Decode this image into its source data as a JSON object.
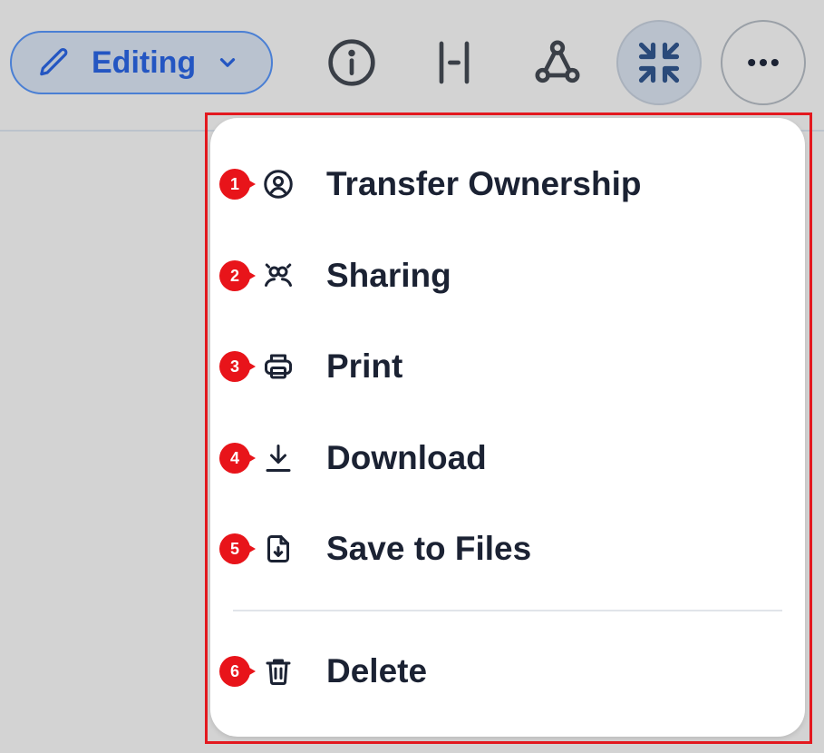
{
  "toolbar": {
    "editing_label": "Editing"
  },
  "menu": {
    "items": [
      {
        "badge": "1",
        "label": "Transfer Ownership",
        "icon": "user-circle-icon"
      },
      {
        "badge": "2",
        "label": "Sharing",
        "icon": "users-icon"
      },
      {
        "badge": "3",
        "label": "Print",
        "icon": "printer-icon"
      },
      {
        "badge": "4",
        "label": "Download",
        "icon": "download-icon"
      },
      {
        "badge": "5",
        "label": "Save to Files",
        "icon": "file-download-icon"
      },
      {
        "badge": "6",
        "label": "Delete",
        "icon": "trash-icon"
      }
    ]
  },
  "colors": {
    "accent": "#2456c2",
    "badge": "#e8141a",
    "highlight": "#e3191f",
    "text": "#1b2233"
  }
}
